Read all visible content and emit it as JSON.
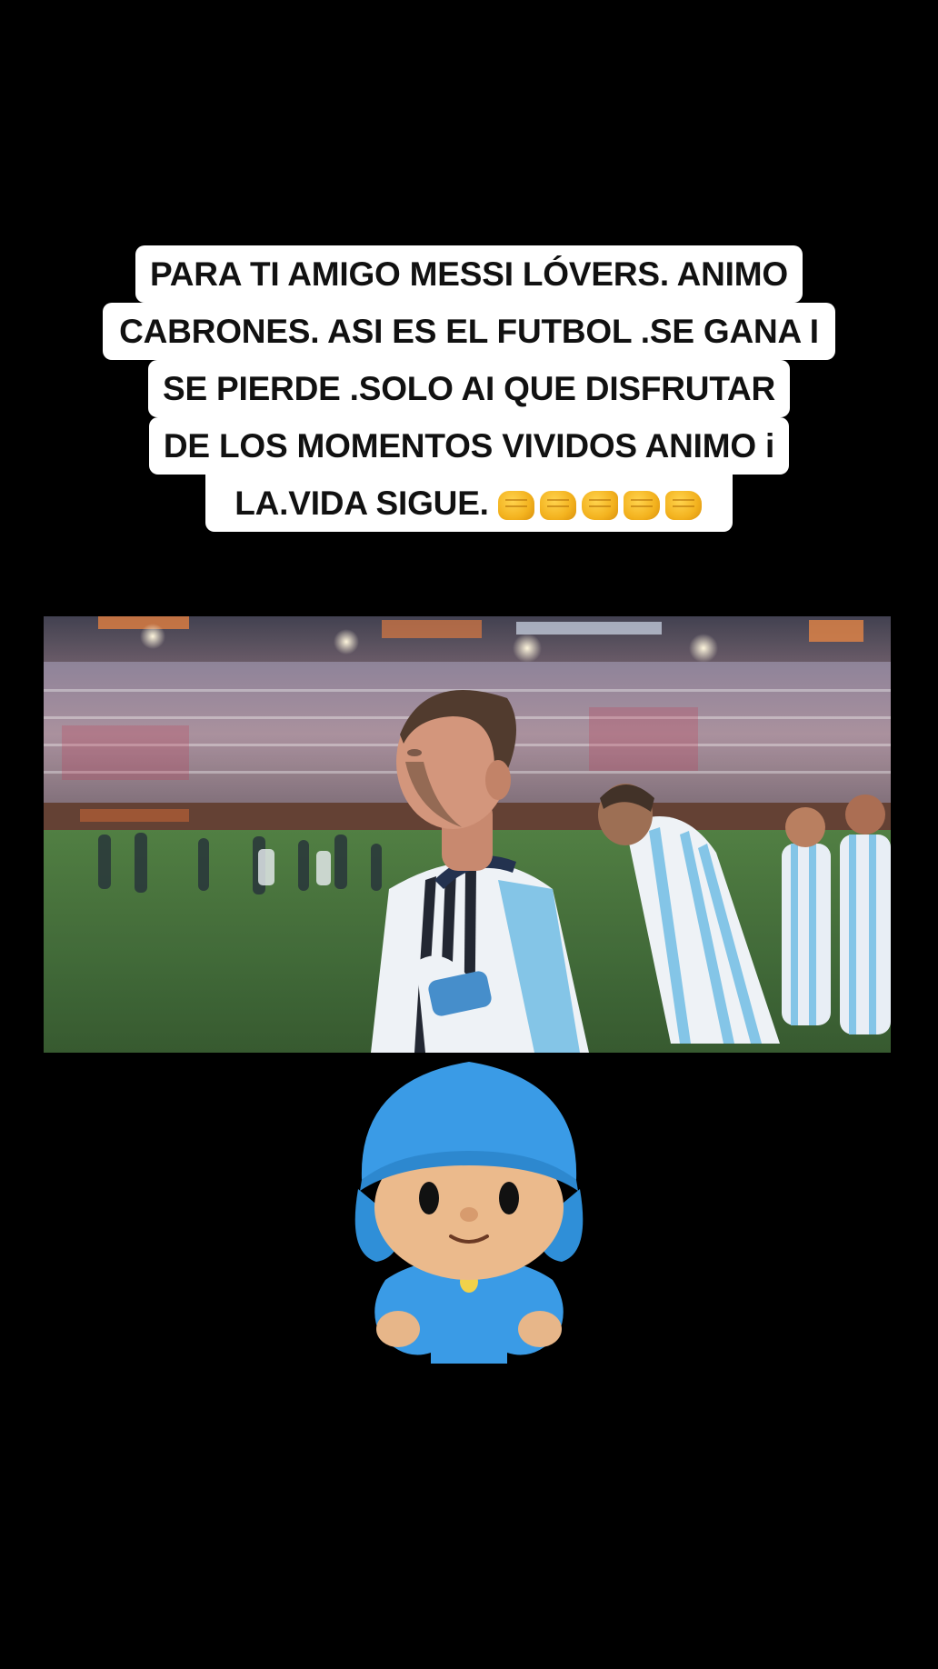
{
  "caption": {
    "lines": [
      "PARA TI AMIGO  MESSI LÓVERS. ANIMO",
      "CABRONES. ASI ES EL FUTBOL .SE GANA I",
      "SE PIERDE .SOLO AI QUE DISFRUTAR",
      "DE LOS MOMENTOS VIVIDOS ANIMO  i",
      "LA.VIDA SIGUE."
    ],
    "emojis": [
      "fist-icon",
      "fist-icon",
      "left-facing-fist-icon",
      "right-facing-fist-icon",
      "right-facing-fist-icon"
    ]
  },
  "video": {
    "description_icon": "stadium-photo",
    "colors": {
      "grass": "#3f6a34",
      "jersey_blue": "#79c0e4",
      "jersey_white": "#f2f4f7"
    }
  },
  "sticker": {
    "icon": "pocoyo-character-icon",
    "colors": {
      "hat": "#3a9be0",
      "face": "#e9b889",
      "body": "#2f8fe0"
    }
  }
}
